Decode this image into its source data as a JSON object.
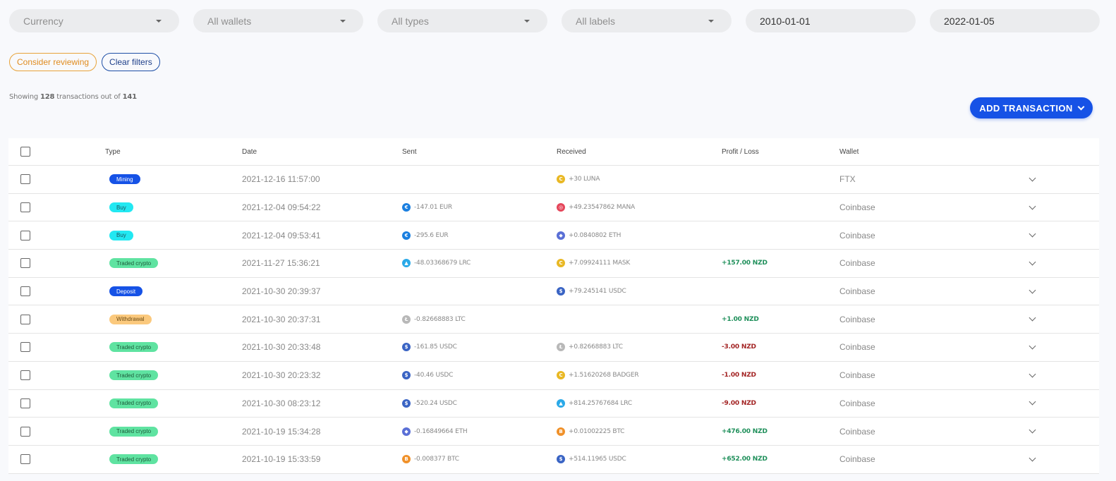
{
  "filters": {
    "currency": "Currency",
    "wallets": "All wallets",
    "types": "All types",
    "labels": "All labels",
    "date_from": "2010-01-01",
    "date_to": "2022-01-05"
  },
  "buttons": {
    "consider_reviewing": "Consider reviewing",
    "clear_filters": "Clear filters",
    "add_transaction": "ADD TRANSACTION"
  },
  "summary": {
    "prefix": "Showing",
    "shown": "128",
    "middle": "transactions out of",
    "total": "141"
  },
  "colors": {
    "accent": "#1652e6",
    "profit": "#1e8f5a",
    "loss": "#a32424"
  },
  "table": {
    "headers": {
      "type": "Type",
      "date": "Date",
      "sent": "Sent",
      "received": "Received",
      "profit_loss": "Profit / Loss",
      "wallet": "Wallet"
    },
    "rows": [
      {
        "type": "Mining",
        "date": "2021-12-16 11:57:00",
        "sent": null,
        "received": {
          "amount": "+30 LUNA",
          "icon": "luna-icon"
        },
        "pl": null,
        "wallet": "FTX"
      },
      {
        "type": "Buy",
        "date": "2021-12-04 09:54:22",
        "sent": {
          "amount": "-147.01 EUR",
          "icon": "eur-icon"
        },
        "received": {
          "amount": "+49.23547862 MANA",
          "icon": "mana-icon"
        },
        "pl": null,
        "wallet": "Coinbase"
      },
      {
        "type": "Buy",
        "date": "2021-12-04 09:53:41",
        "sent": {
          "amount": "-295.6 EUR",
          "icon": "eur-icon"
        },
        "received": {
          "amount": "+0.0840802 ETH",
          "icon": "eth-icon"
        },
        "pl": null,
        "wallet": "Coinbase"
      },
      {
        "type": "Traded crypto",
        "date": "2021-11-27 15:36:21",
        "sent": {
          "amount": "-48.03368679 LRC",
          "icon": "lrc-icon"
        },
        "received": {
          "amount": "+7.09924111 MASK",
          "icon": "mask-icon"
        },
        "pl": {
          "value": "+157.00 NZD",
          "sign": "profit"
        },
        "wallet": "Coinbase"
      },
      {
        "type": "Deposit",
        "date": "2021-10-30 20:39:37",
        "sent": null,
        "received": {
          "amount": "+79.245141 USDC",
          "icon": "usdc-icon"
        },
        "pl": null,
        "wallet": "Coinbase"
      },
      {
        "type": "Withdrawal",
        "date": "2021-10-30 20:37:31",
        "sent": {
          "amount": "-0.82668883 LTC",
          "icon": "ltc-icon"
        },
        "received": null,
        "pl": {
          "value": "+1.00 NZD",
          "sign": "profit"
        },
        "wallet": "Coinbase"
      },
      {
        "type": "Traded crypto",
        "date": "2021-10-30 20:33:48",
        "sent": {
          "amount": "-161.85 USDC",
          "icon": "usdc-icon"
        },
        "received": {
          "amount": "+0.82668883 LTC",
          "icon": "ltc-icon"
        },
        "pl": {
          "value": "-3.00 NZD",
          "sign": "loss"
        },
        "wallet": "Coinbase"
      },
      {
        "type": "Traded crypto",
        "date": "2021-10-30 20:23:32",
        "sent": {
          "amount": "-40.46 USDC",
          "icon": "usdc-icon"
        },
        "received": {
          "amount": "+1.51620268 BADGER",
          "icon": "badger-icon"
        },
        "pl": {
          "value": "-1.00 NZD",
          "sign": "loss"
        },
        "wallet": "Coinbase"
      },
      {
        "type": "Traded crypto",
        "date": "2021-10-30 08:23:12",
        "sent": {
          "amount": "-520.24 USDC",
          "icon": "usdc-icon"
        },
        "received": {
          "amount": "+814.25767684 LRC",
          "icon": "lrc-icon"
        },
        "pl": {
          "value": "-9.00 NZD",
          "sign": "loss"
        },
        "wallet": "Coinbase"
      },
      {
        "type": "Traded crypto",
        "date": "2021-10-19 15:34:28",
        "sent": {
          "amount": "-0.16849664 ETH",
          "icon": "eth-icon"
        },
        "received": {
          "amount": "+0.01002225 BTC",
          "icon": "btc-icon"
        },
        "pl": {
          "value": "+476.00 NZD",
          "sign": "profit"
        },
        "wallet": "Coinbase"
      },
      {
        "type": "Traded crypto",
        "date": "2021-10-19 15:33:59",
        "sent": {
          "amount": "-0.008377 BTC",
          "icon": "btc-icon"
        },
        "received": {
          "amount": "+514.11965 USDC",
          "icon": "usdc-icon"
        },
        "pl": {
          "value": "+652.00 NZD",
          "sign": "profit"
        },
        "wallet": "Coinbase"
      }
    ]
  }
}
